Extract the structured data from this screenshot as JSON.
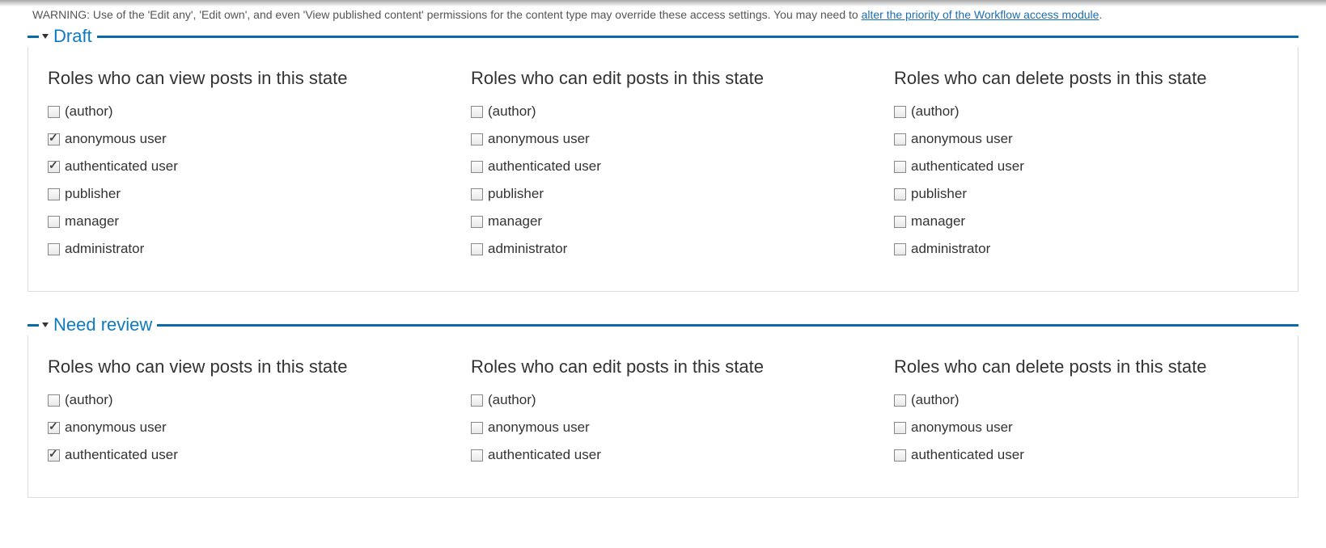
{
  "warning": {
    "prefix": "WARNING: Use of the 'Edit any', 'Edit own', and even 'View published content' permissions for the content type may override these access settings. You may need to ",
    "link": "alter the priority of the Workflow access module",
    "suffix": "."
  },
  "roles": [
    "(author)",
    "anonymous user",
    "authenticated user",
    "publisher",
    "manager",
    "administrator"
  ],
  "states": [
    {
      "title": "Draft",
      "columns": [
        {
          "heading": "Roles who can view posts in this state",
          "checked": [
            false,
            true,
            true,
            false,
            false,
            false
          ]
        },
        {
          "heading": "Roles who can edit posts in this state",
          "checked": [
            false,
            false,
            false,
            false,
            false,
            false
          ]
        },
        {
          "heading": "Roles who can delete posts in this state",
          "checked": [
            false,
            false,
            false,
            false,
            false,
            false
          ]
        }
      ]
    },
    {
      "title": "Need review",
      "columns": [
        {
          "heading": "Roles who can view posts in this state",
          "checked": [
            false,
            true,
            true
          ]
        },
        {
          "heading": "Roles who can edit posts in this state",
          "checked": [
            false,
            false,
            false
          ]
        },
        {
          "heading": "Roles who can delete posts in this state",
          "checked": [
            false,
            false,
            false
          ]
        }
      ]
    }
  ]
}
